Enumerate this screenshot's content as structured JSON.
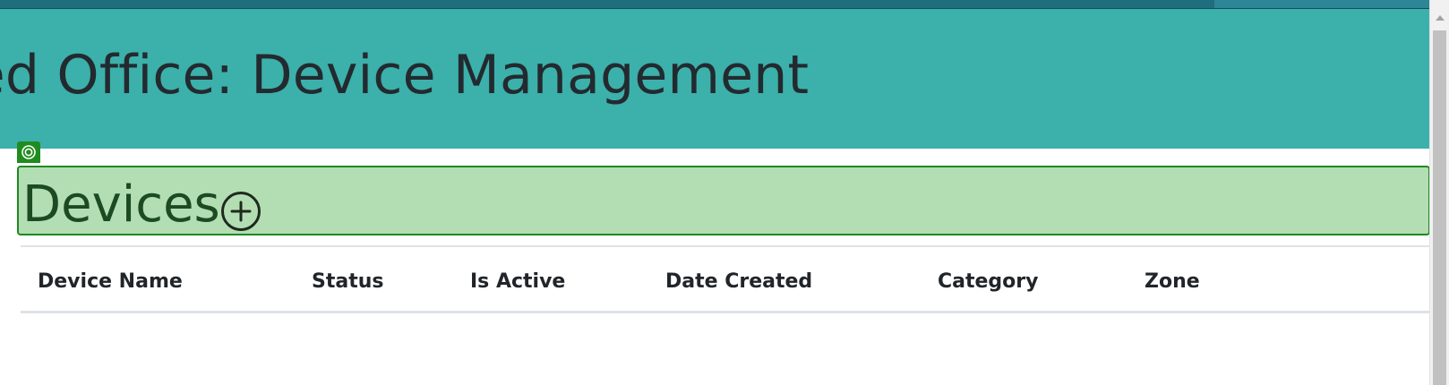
{
  "header": {
    "title": "ted Office: Device Management"
  },
  "section": {
    "title": "Devices",
    "add_icon": "plus-circle-icon",
    "inspector_icon": "target-icon"
  },
  "table": {
    "columns": [
      "Device Name",
      "Status",
      "Is Active",
      "Date Created",
      "Category",
      "Zone"
    ],
    "rows": []
  },
  "colors": {
    "header_bg": "#3cb0ab",
    "topbar": "#1e6e7e",
    "highlight_bg": "#b3deb3",
    "highlight_border": "#1f8a1f",
    "text_dark": "#232a2f"
  }
}
